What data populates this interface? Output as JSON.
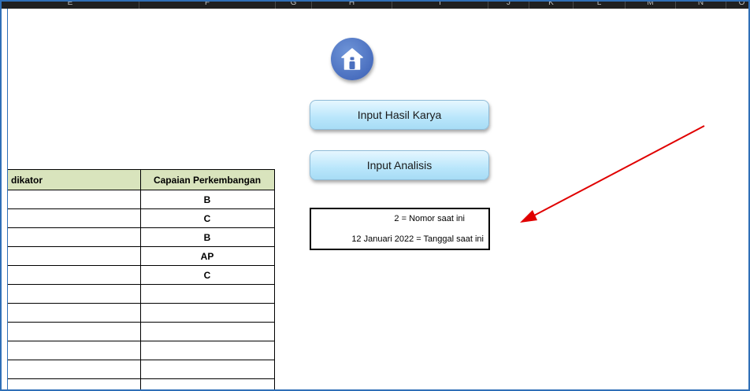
{
  "sheet": {
    "column_headers": [
      "E",
      "F",
      "G",
      "H",
      "I",
      "J",
      "K",
      "L",
      "M",
      "N",
      "O"
    ]
  },
  "table": {
    "headers": [
      "dikator",
      "Capaian Perkembangan"
    ],
    "rows": [
      [
        "",
        "B"
      ],
      [
        "",
        "C"
      ],
      [
        "",
        "B"
      ],
      [
        "",
        "AP"
      ],
      [
        "",
        "C"
      ],
      [
        "",
        ""
      ],
      [
        "",
        ""
      ],
      [
        "",
        ""
      ],
      [
        "",
        ""
      ],
      [
        "",
        ""
      ],
      [
        "",
        ""
      ]
    ]
  },
  "buttons": {
    "home_icon": "home-icon",
    "input_hasil_karya": "Input Hasil Karya",
    "input_analisis": "Input Analisis"
  },
  "info": {
    "line1": "2 = Nomor saat ini",
    "line2": "12 Januari 2022 = Tanggal saat ini"
  },
  "colors": {
    "table_header_bg": "#d9e4bd",
    "button_bg": "#b9e6fb",
    "home_button": "#4a6fbf",
    "arrow": "#e00000"
  }
}
